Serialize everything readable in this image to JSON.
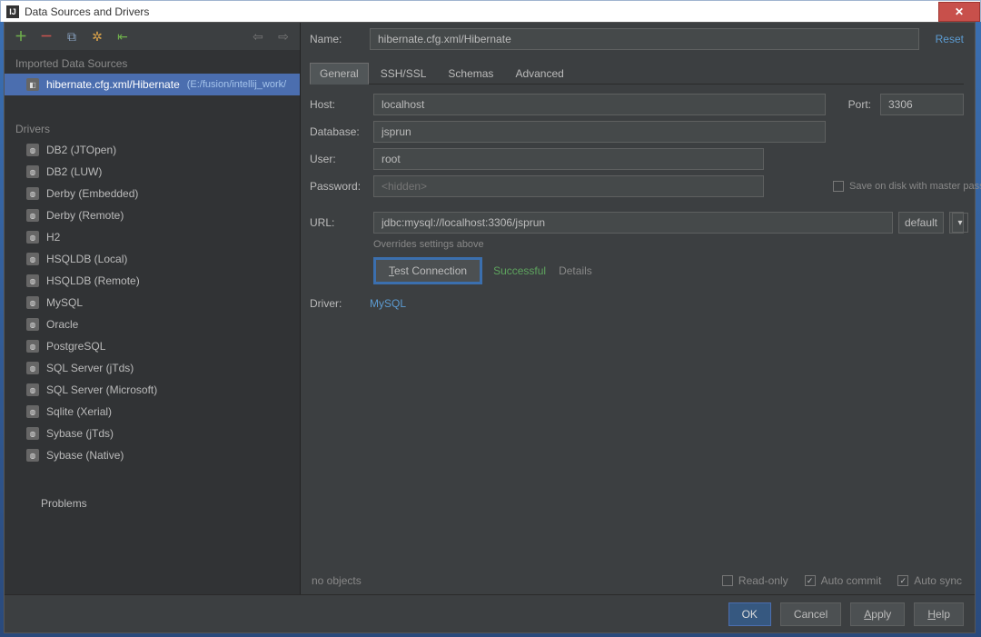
{
  "window": {
    "title": "Data Sources and Drivers"
  },
  "sidebar": {
    "sections": [
      "Imported Data Sources",
      "Drivers"
    ],
    "dataSource": {
      "label": "hibernate.cfg.xml/Hibernate",
      "path": "(E:/fusion/intellij_work/"
    },
    "drivers": [
      "DB2 (JTOpen)",
      "DB2 (LUW)",
      "Derby (Embedded)",
      "Derby (Remote)",
      "H2",
      "HSQLDB (Local)",
      "HSQLDB (Remote)",
      "MySQL",
      "Oracle",
      "PostgreSQL",
      "SQL Server (jTds)",
      "SQL Server (Microsoft)",
      "Sqlite (Xerial)",
      "Sybase (jTds)",
      "Sybase (Native)"
    ],
    "problems": "Problems"
  },
  "header": {
    "name_label": "Name:",
    "name_value": "hibernate.cfg.xml/Hibernate",
    "reset": "Reset"
  },
  "tabs": [
    "General",
    "SSH/SSL",
    "Schemas",
    "Advanced"
  ],
  "form": {
    "host_label": "Host:",
    "host_value": "localhost",
    "port_label": "Port:",
    "port_value": "3306",
    "database_label": "Database:",
    "database_value": "jsprun",
    "user_label": "User:",
    "user_value": "root",
    "password_label": "Password:",
    "password_placeholder": "<hidden>",
    "save_on_disk": "Save on disk with master password protection",
    "url_label": "URL:",
    "url_value": "jdbc:mysql://localhost:3306/jsprun",
    "url_mode": "default",
    "url_hint": "Overrides settings above",
    "test_btn": "Test Connection",
    "test_result": "Successful",
    "test_details": "Details",
    "driver_label": "Driver:",
    "driver_value": "MySQL"
  },
  "footer": {
    "no_objects": "no objects",
    "read_only": "Read-only",
    "auto_commit": "Auto commit",
    "auto_sync": "Auto sync"
  },
  "buttons": {
    "ok": "OK",
    "cancel": "Cancel",
    "apply": "Apply",
    "help": "Help"
  }
}
